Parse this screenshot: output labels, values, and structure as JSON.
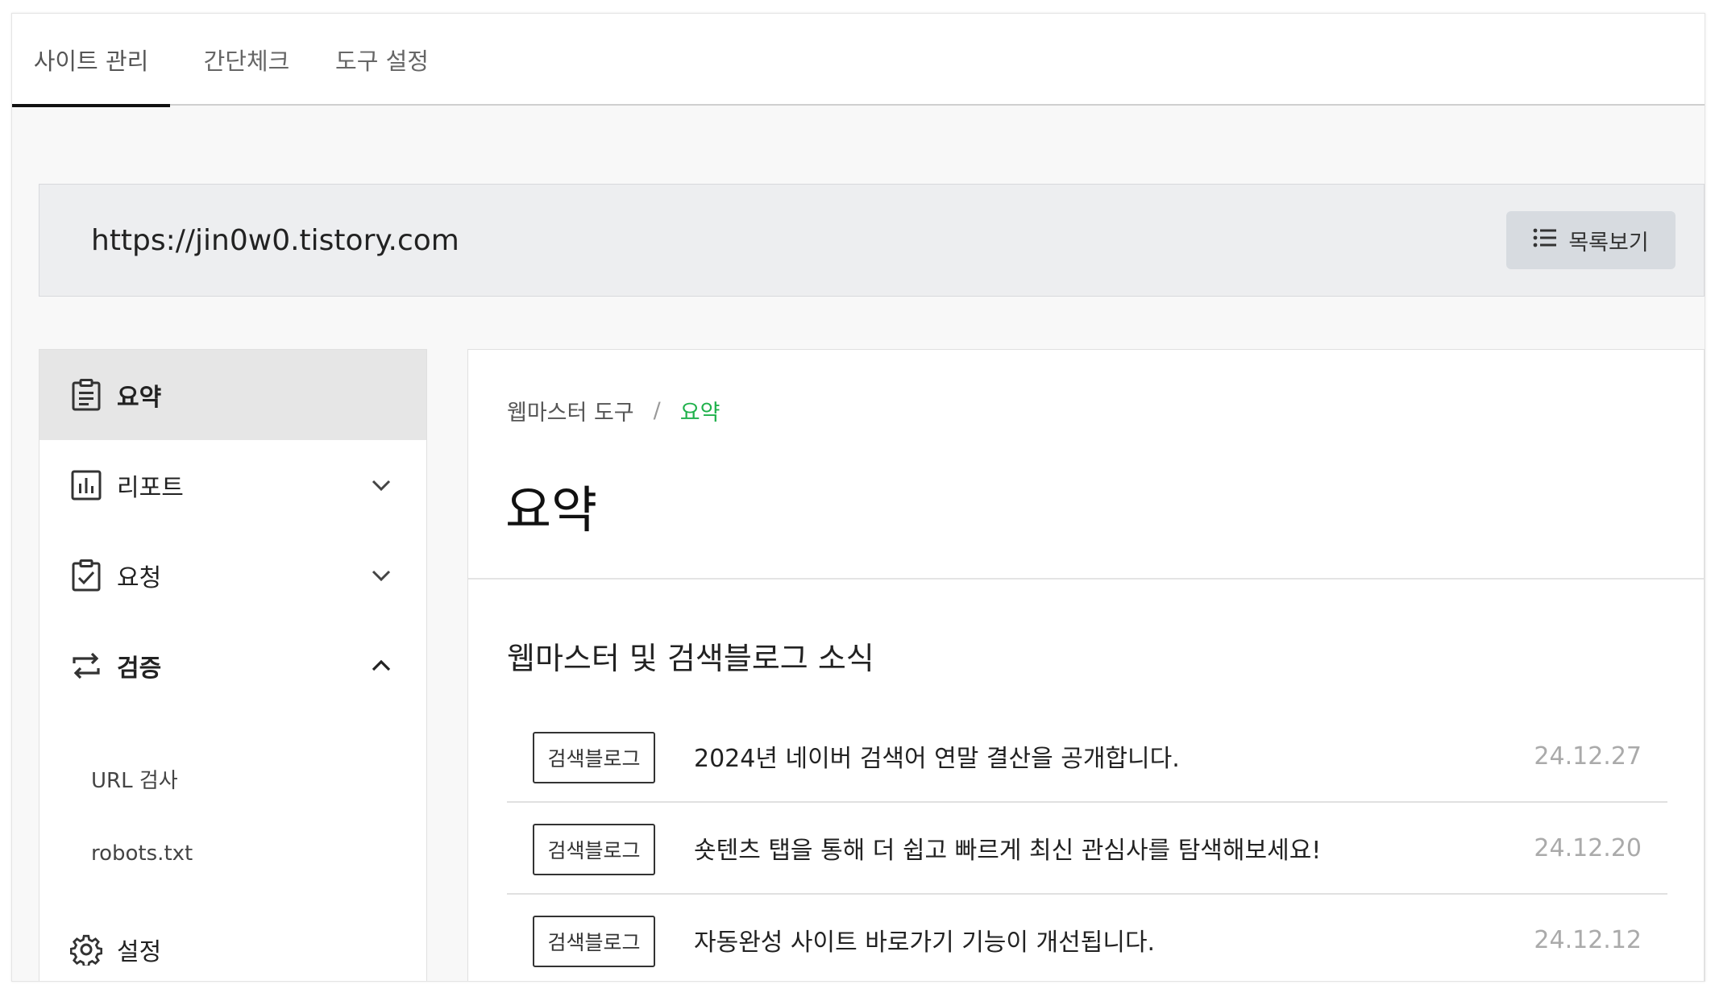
{
  "tabs": [
    {
      "label": "사이트 관리",
      "active": true
    },
    {
      "label": "간단체크",
      "active": false
    },
    {
      "label": "도구 설정",
      "active": false
    }
  ],
  "site": {
    "url": "https://jin0w0.tistory.com",
    "list_button_label": "목록보기"
  },
  "sidebar": {
    "items": [
      {
        "label": "요약",
        "icon": "clipboard-list-icon",
        "active": true
      },
      {
        "label": "리포트",
        "icon": "bar-chart-icon",
        "expanded": false
      },
      {
        "label": "요청",
        "icon": "clipboard-check-icon",
        "expanded": false
      },
      {
        "label": "검증",
        "icon": "repeat-icon",
        "expanded": true
      },
      {
        "label": "설정",
        "icon": "gear-icon"
      }
    ],
    "sub_items": [
      {
        "label": "URL 검사"
      },
      {
        "label": "robots.txt"
      }
    ]
  },
  "breadcrumb": {
    "root": "웹마스터 도구",
    "separator": "/",
    "current": "요약"
  },
  "main": {
    "title": "요약",
    "section_title": "웹마스터 및 검색블로그 소식",
    "news": [
      {
        "tag": "검색블로그",
        "title": "2024년 네이버 검색어 연말 결산을 공개합니다.",
        "date": "24.12.27"
      },
      {
        "tag": "검색블로그",
        "title": "숏텐츠 탭을 통해 더 쉽고 빠르게 최신 관심사를 탐색해보세요!",
        "date": "24.12.20"
      },
      {
        "tag": "검색블로그",
        "title": "자동완성 사이트 바로가기 기능이 개선됩니다.",
        "date": "24.12.12"
      }
    ]
  },
  "colors": {
    "accent_green": "#1fb14b",
    "active_tab_underline": "#111111"
  }
}
